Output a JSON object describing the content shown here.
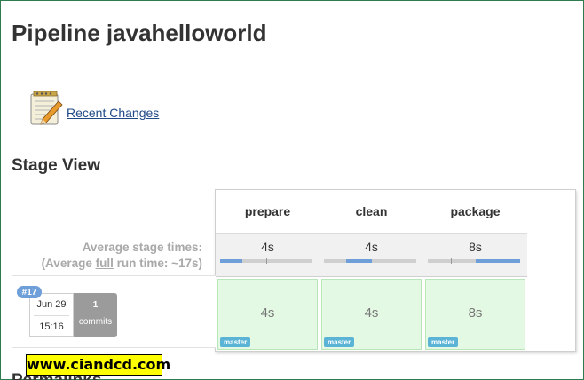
{
  "page": {
    "title": "Pipeline javahelloworld"
  },
  "tasks": [
    {
      "label": "Recent Changes",
      "icon": "notepad-icon"
    }
  ],
  "stage_view": {
    "heading": "Stage View",
    "avg_label_line1": "Average stage times:",
    "avg_label_prefix": "(Average ",
    "avg_label_full": "full",
    "avg_label_suffix": " run time: ~17s)",
    "stages": [
      {
        "name": "prepare",
        "avg": "4s",
        "progress_start": 0.0,
        "progress_end": 0.24
      },
      {
        "name": "clean",
        "avg": "4s",
        "progress_start": 0.24,
        "progress_end": 0.52
      },
      {
        "name": "package",
        "avg": "8s",
        "progress_start": 0.52,
        "progress_end": 1.0
      }
    ],
    "runs": [
      {
        "number": "#17",
        "date": "Jun 29",
        "time": "15:16",
        "commits_count": "1",
        "commits_label": "commits",
        "cells": [
          {
            "duration": "4s",
            "branch": "master"
          },
          {
            "duration": "4s",
            "branch": "master"
          },
          {
            "duration": "8s",
            "branch": "master"
          }
        ]
      }
    ]
  },
  "watermark": "www.ciandcd.com",
  "next_heading_partial": "Permalinks",
  "colors": {
    "success_bg": "#e3f9e3",
    "progress": "#6e9fd8",
    "branch_badge": "#5bb4d6",
    "run_badge": "#6e9fd8"
  }
}
